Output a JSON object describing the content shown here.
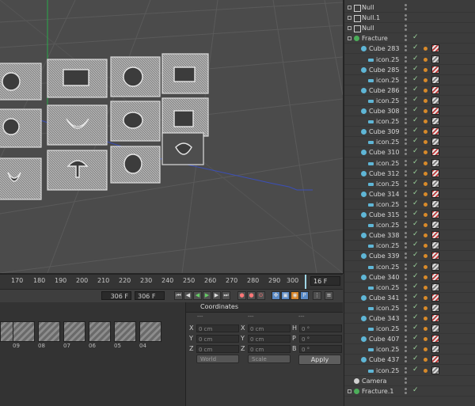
{
  "timeline": {
    "ticks": [
      "170",
      "180",
      "190",
      "200",
      "210",
      "220",
      "230",
      "240",
      "250",
      "260",
      "270",
      "280",
      "290",
      "300"
    ],
    "current_frame": "16 F"
  },
  "transport": {
    "start_field": "306 F",
    "end_field": "306 F"
  },
  "materials": {
    "items": [
      "09",
      "08",
      "07",
      "06",
      "05",
      "04"
    ]
  },
  "coordinates": {
    "title": "Coordinates",
    "col_heads": [
      "---",
      "---",
      "---"
    ],
    "rows": [
      {
        "l1": "X",
        "v1": "0 cm",
        "l2": "X",
        "v2": "0 cm",
        "l3": "H",
        "v3": "0 °"
      },
      {
        "l1": "Y",
        "v1": "0 cm",
        "l2": "Y",
        "v2": "0 cm",
        "l3": "P",
        "v3": "0 °"
      },
      {
        "l1": "Z",
        "v1": "0 cm",
        "l2": "Z",
        "v2": "0 cm",
        "l3": "B",
        "v3": "0 °"
      }
    ],
    "mode_select": "World",
    "scale_select": "Scale",
    "apply_label": "Apply"
  },
  "objects": [
    {
      "name": "Null",
      "level": 0,
      "type": "null"
    },
    {
      "name": "Null.1",
      "level": 0,
      "type": "null"
    },
    {
      "name": "Null",
      "level": 0,
      "type": "null"
    },
    {
      "name": "Fracture",
      "level": 0,
      "type": "fracture"
    },
    {
      "name": "Cube 283",
      "level": 1,
      "type": "cube"
    },
    {
      "name": "icon.25",
      "level": 2,
      "type": "poly"
    },
    {
      "name": "Cube 285",
      "level": 1,
      "type": "cube"
    },
    {
      "name": "icon.25",
      "level": 2,
      "type": "poly"
    },
    {
      "name": "Cube 286",
      "level": 1,
      "type": "cube"
    },
    {
      "name": "icon.25",
      "level": 2,
      "type": "poly"
    },
    {
      "name": "Cube 308",
      "level": 1,
      "type": "cube"
    },
    {
      "name": "icon.25",
      "level": 2,
      "type": "poly"
    },
    {
      "name": "Cube 309",
      "level": 1,
      "type": "cube"
    },
    {
      "name": "icon.25",
      "level": 2,
      "type": "poly"
    },
    {
      "name": "Cube 310",
      "level": 1,
      "type": "cube"
    },
    {
      "name": "icon.25",
      "level": 2,
      "type": "poly"
    },
    {
      "name": "Cube 312",
      "level": 1,
      "type": "cube"
    },
    {
      "name": "icon.25",
      "level": 2,
      "type": "poly"
    },
    {
      "name": "Cube 314",
      "level": 1,
      "type": "cube"
    },
    {
      "name": "icon.25",
      "level": 2,
      "type": "poly"
    },
    {
      "name": "Cube 315",
      "level": 1,
      "type": "cube"
    },
    {
      "name": "icon.25",
      "level": 2,
      "type": "poly"
    },
    {
      "name": "Cube 338",
      "level": 1,
      "type": "cube"
    },
    {
      "name": "icon.25",
      "level": 2,
      "type": "poly"
    },
    {
      "name": "Cube 339",
      "level": 1,
      "type": "cube"
    },
    {
      "name": "icon.25",
      "level": 2,
      "type": "poly"
    },
    {
      "name": "Cube 340",
      "level": 1,
      "type": "cube"
    },
    {
      "name": "icon.25",
      "level": 2,
      "type": "poly"
    },
    {
      "name": "Cube 341",
      "level": 1,
      "type": "cube"
    },
    {
      "name": "icon.25",
      "level": 2,
      "type": "poly"
    },
    {
      "name": "Cube 343",
      "level": 1,
      "type": "cube"
    },
    {
      "name": "icon.25",
      "level": 2,
      "type": "poly"
    },
    {
      "name": "Cube 407",
      "level": 1,
      "type": "cube"
    },
    {
      "name": "icon.25",
      "level": 2,
      "type": "poly"
    },
    {
      "name": "Cube 437",
      "level": 1,
      "type": "cube"
    },
    {
      "name": "icon.25",
      "level": 2,
      "type": "poly"
    },
    {
      "name": "Camera",
      "level": 0,
      "type": "camera"
    },
    {
      "name": "Fracture.1",
      "level": 0,
      "type": "fracture"
    }
  ],
  "colors": {
    "cube_icon": "#5fb6d6",
    "poly_icon": "#5fb6d6",
    "null_icon": "#cfcfcf",
    "fracture_icon": "#4cae5a",
    "camera_icon": "#d0d0d0",
    "axis_y": "#2aa84a",
    "axis_z": "#3b4fb8"
  }
}
